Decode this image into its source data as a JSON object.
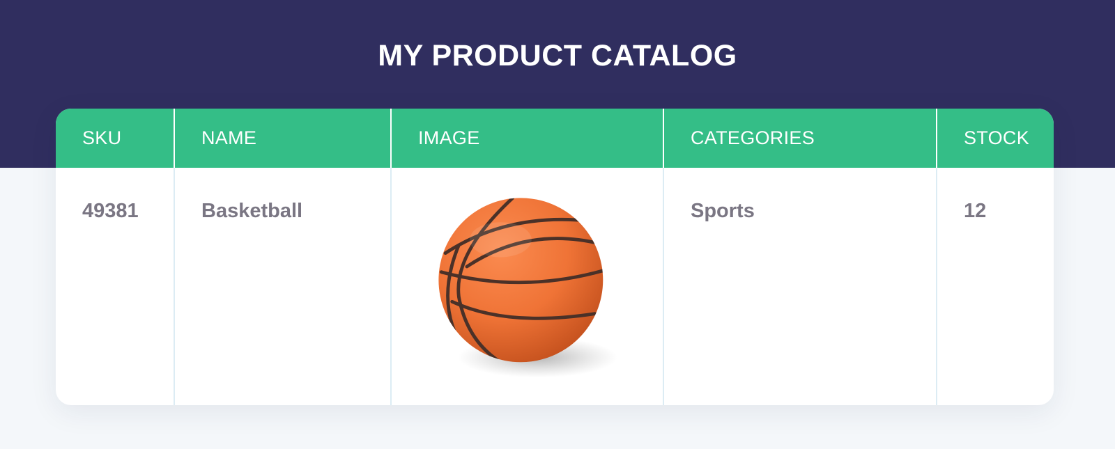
{
  "page": {
    "title": "MY PRODUCT CATALOG"
  },
  "colors": {
    "header_band": "#302e5f",
    "table_header": "#34be87",
    "cell_text": "#7a7683",
    "page_background": "#f4f7fa"
  },
  "table": {
    "columns": [
      "SKU",
      "NAME",
      "IMAGE",
      "CATEGORIES",
      "STOCK"
    ],
    "rows": [
      {
        "sku": "49381",
        "name": "Basketball",
        "image": "basketball-image",
        "categories": "Sports",
        "stock": "12"
      }
    ]
  }
}
